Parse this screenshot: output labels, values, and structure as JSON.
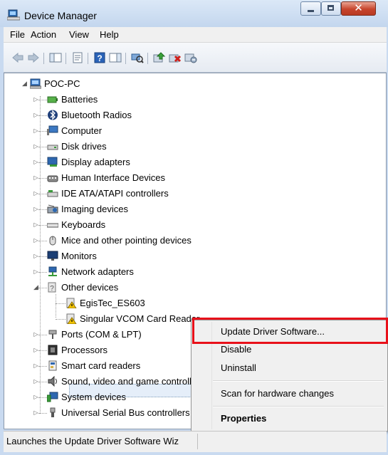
{
  "window": {
    "title": "Device Manager"
  },
  "menu": {
    "items": [
      "File",
      "Action",
      "View",
      "Help"
    ]
  },
  "toolbar": {
    "buttons": [
      "back-icon",
      "forward-icon",
      "show-hide-console-tree-icon",
      "properties-icon",
      "help-icon",
      "show-hide-action-pane-icon",
      "scan-hardware-icon",
      "update-driver-icon",
      "uninstall-icon",
      "disable-icon"
    ]
  },
  "tree": {
    "root": "POC-PC",
    "categories": [
      "Batteries",
      "Bluetooth Radios",
      "Computer",
      "Disk drives",
      "Display adapters",
      "Human Interface Devices",
      "IDE ATA/ATAPI controllers",
      "Imaging devices",
      "Keyboards",
      "Mice and other pointing devices",
      "Monitors",
      "Network adapters",
      "Other devices",
      "EgisTec_ES603",
      "Singular VCOM Card Reader",
      "Ports (COM & LPT)",
      "Processors",
      "Smart card readers",
      "Sound, video and game controllers",
      "System devices",
      "Universal Serial Bus controllers"
    ],
    "selected": "Singular VCOM Card Reader"
  },
  "context_menu": {
    "items": [
      "Update Driver Software...",
      "Disable",
      "Uninstall",
      "Scan for hardware changes",
      "Properties"
    ],
    "highlighted": "Update Driver Software..."
  },
  "status": {
    "text": "Launches the Update Driver Software Wiz"
  },
  "colors": {
    "highlight_border": "#e8111a",
    "warning_icon": "#f2c300"
  }
}
